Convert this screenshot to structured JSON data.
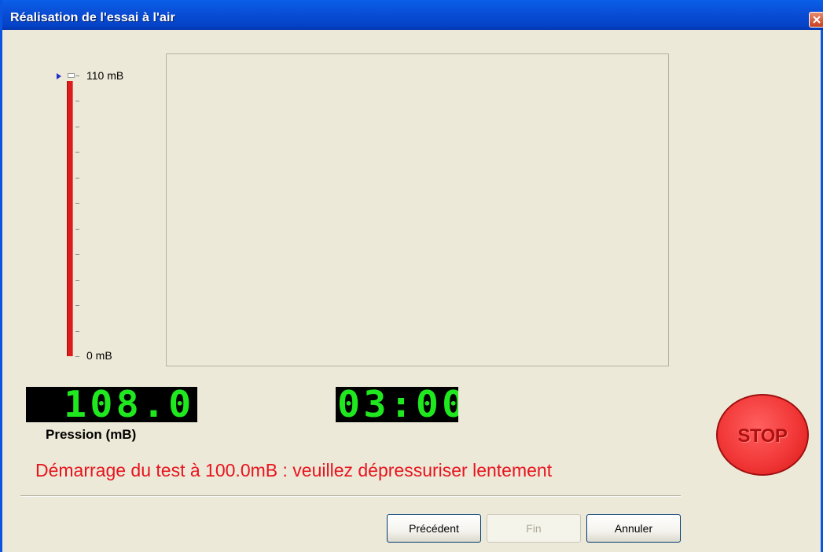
{
  "window": {
    "title": "Réalisation de l'essai à l'air"
  },
  "gauge": {
    "max_label": "110 mB",
    "min_label": "0 mB",
    "level_fraction": 0.98,
    "bar_color": "#dd1c1c"
  },
  "pressure_display": {
    "value": "108.0",
    "label": "Pression (mB)"
  },
  "timer_display": {
    "value": "03:00"
  },
  "status_message": "Démarrage du test à 100.0mB : veuillez dépressuriser lentement",
  "stop_button": {
    "label": "STOP"
  },
  "buttons": {
    "previous": "Précédent",
    "finish": "Fin",
    "cancel": "Annuler"
  },
  "colors": {
    "title_bar": "#0a4fd8",
    "lcd_digits": "#1fe81f",
    "message": "#e8141e",
    "stop": "#f23838"
  }
}
